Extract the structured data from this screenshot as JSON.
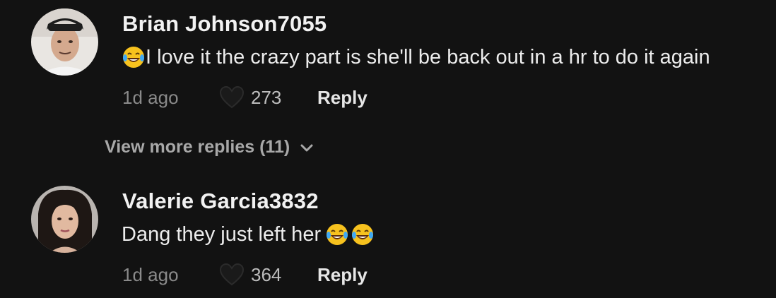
{
  "comments": [
    {
      "username": "Brian Johnson7055",
      "text": "I love it the crazy part is she'll be back out in a hr to do it again",
      "leading_emoji": "face-with-tears-of-joy",
      "timestamp": "1d ago",
      "likes": "273",
      "reply_label": "Reply"
    },
    {
      "username": "Valerie Garcia3832",
      "text": "Dang they just left her ",
      "trailing_emoji_count": 2,
      "trailing_emoji": "face-with-tears-of-joy",
      "timestamp": "1d ago",
      "likes": "364",
      "reply_label": "Reply"
    }
  ],
  "view_more_replies": {
    "label": "View more replies (11)",
    "icon": "chevron-down-icon"
  },
  "colors": {
    "background": "#121212",
    "username": "#f2f2f2",
    "text": "#ececec",
    "meta": "#8a8a8a",
    "emoji": "#f7c21e"
  }
}
